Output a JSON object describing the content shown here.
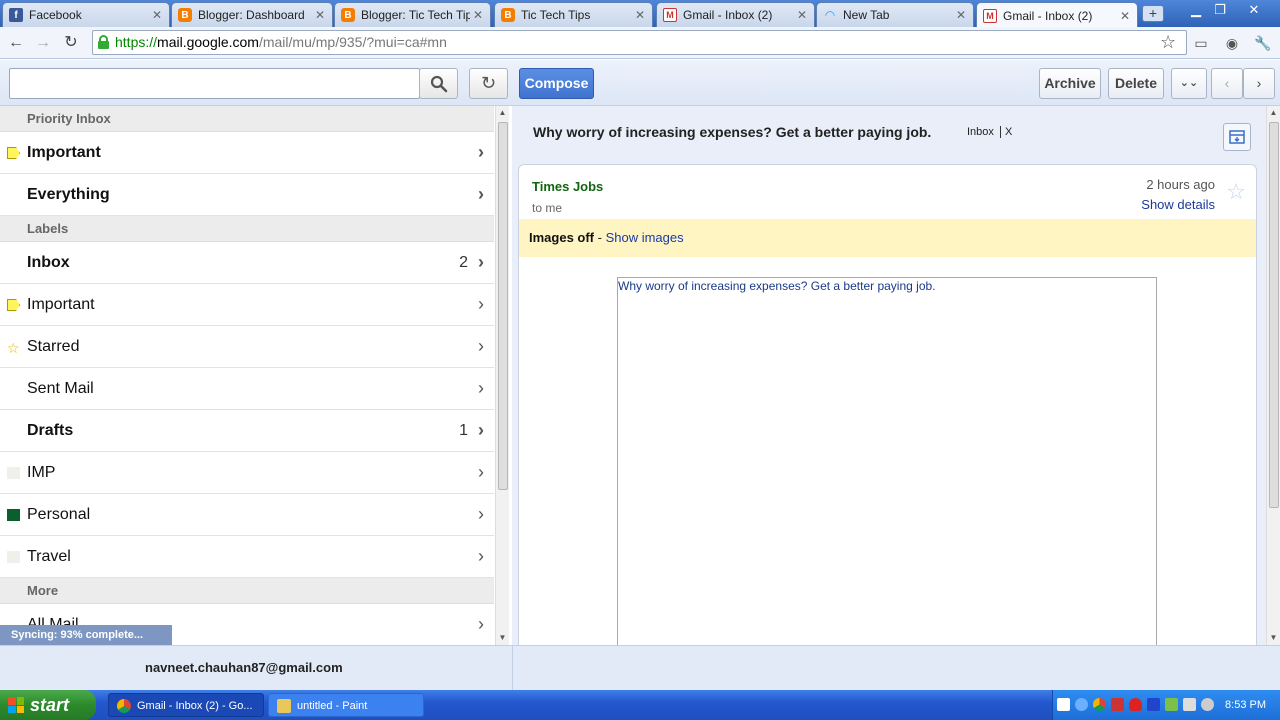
{
  "browser": {
    "tabs": [
      {
        "label": "Facebook",
        "icon": "facebook-icon"
      },
      {
        "label": "Blogger: Dashboard",
        "icon": "blogger-icon"
      },
      {
        "label": "Blogger: Tic Tech Tips -",
        "icon": "blogger-icon"
      },
      {
        "label": "Tic Tech Tips",
        "icon": "blogger-icon"
      },
      {
        "label": "Gmail - Inbox (2)",
        "icon": "gmail-icon"
      },
      {
        "label": "New Tab",
        "icon": "loading-icon"
      },
      {
        "label": "Gmail - Inbox (2)",
        "icon": "gmail-icon"
      }
    ],
    "url": {
      "scheme": "https://",
      "host": "mail.google.com",
      "path": "/mail/mu/mp/935/?mui=ca#mn"
    }
  },
  "gmail": {
    "toolbar": {
      "search_placeholder": "",
      "compose_label": "Compose",
      "archive_label": "Archive",
      "delete_label": "Delete"
    },
    "sidebar": {
      "priority_header": "Priority Inbox",
      "priority_items": [
        {
          "label": "Important"
        },
        {
          "label": "Everything"
        }
      ],
      "labels_header": "Labels",
      "label_items": [
        {
          "label": "Inbox",
          "count": "2"
        },
        {
          "label": "Important"
        },
        {
          "label": "Starred"
        },
        {
          "label": "Sent Mail"
        },
        {
          "label": "Drafts",
          "count": "1"
        },
        {
          "label": "IMP",
          "color": "#f0f0ea"
        },
        {
          "label": "Personal",
          "color": "#0b5e2e"
        },
        {
          "label": "Travel",
          "color": "#f0f0ea"
        }
      ],
      "more_header": "More",
      "more_items": [
        {
          "label": "All Mail"
        }
      ]
    },
    "sync_status": "Syncing: 93% complete...",
    "message": {
      "subject": "Why worry of increasing expenses? Get a better paying job.",
      "label_chip": "Inbox",
      "label_remove": "X",
      "sender": "Times Jobs",
      "recipient": "to me",
      "time": "2 hours ago",
      "show_details": "Show details",
      "images_off": "Images off",
      "images_sep": " - ",
      "show_images": "Show images",
      "body_text": "Why worry of increasing expenses? Get a better paying job."
    },
    "account": "navneet.chauhan87@gmail.com"
  },
  "taskbar": {
    "start_label": "start",
    "items": [
      {
        "label": "Gmail - Inbox (2) - Go..."
      },
      {
        "label": "untitled - Paint"
      }
    ],
    "clock": "8:53 PM"
  },
  "colors": {
    "accent": "#3f73cf",
    "sender_green": "#116611",
    "link_blue": "#1a3aaa",
    "label_personal": "#0b5e2e"
  }
}
